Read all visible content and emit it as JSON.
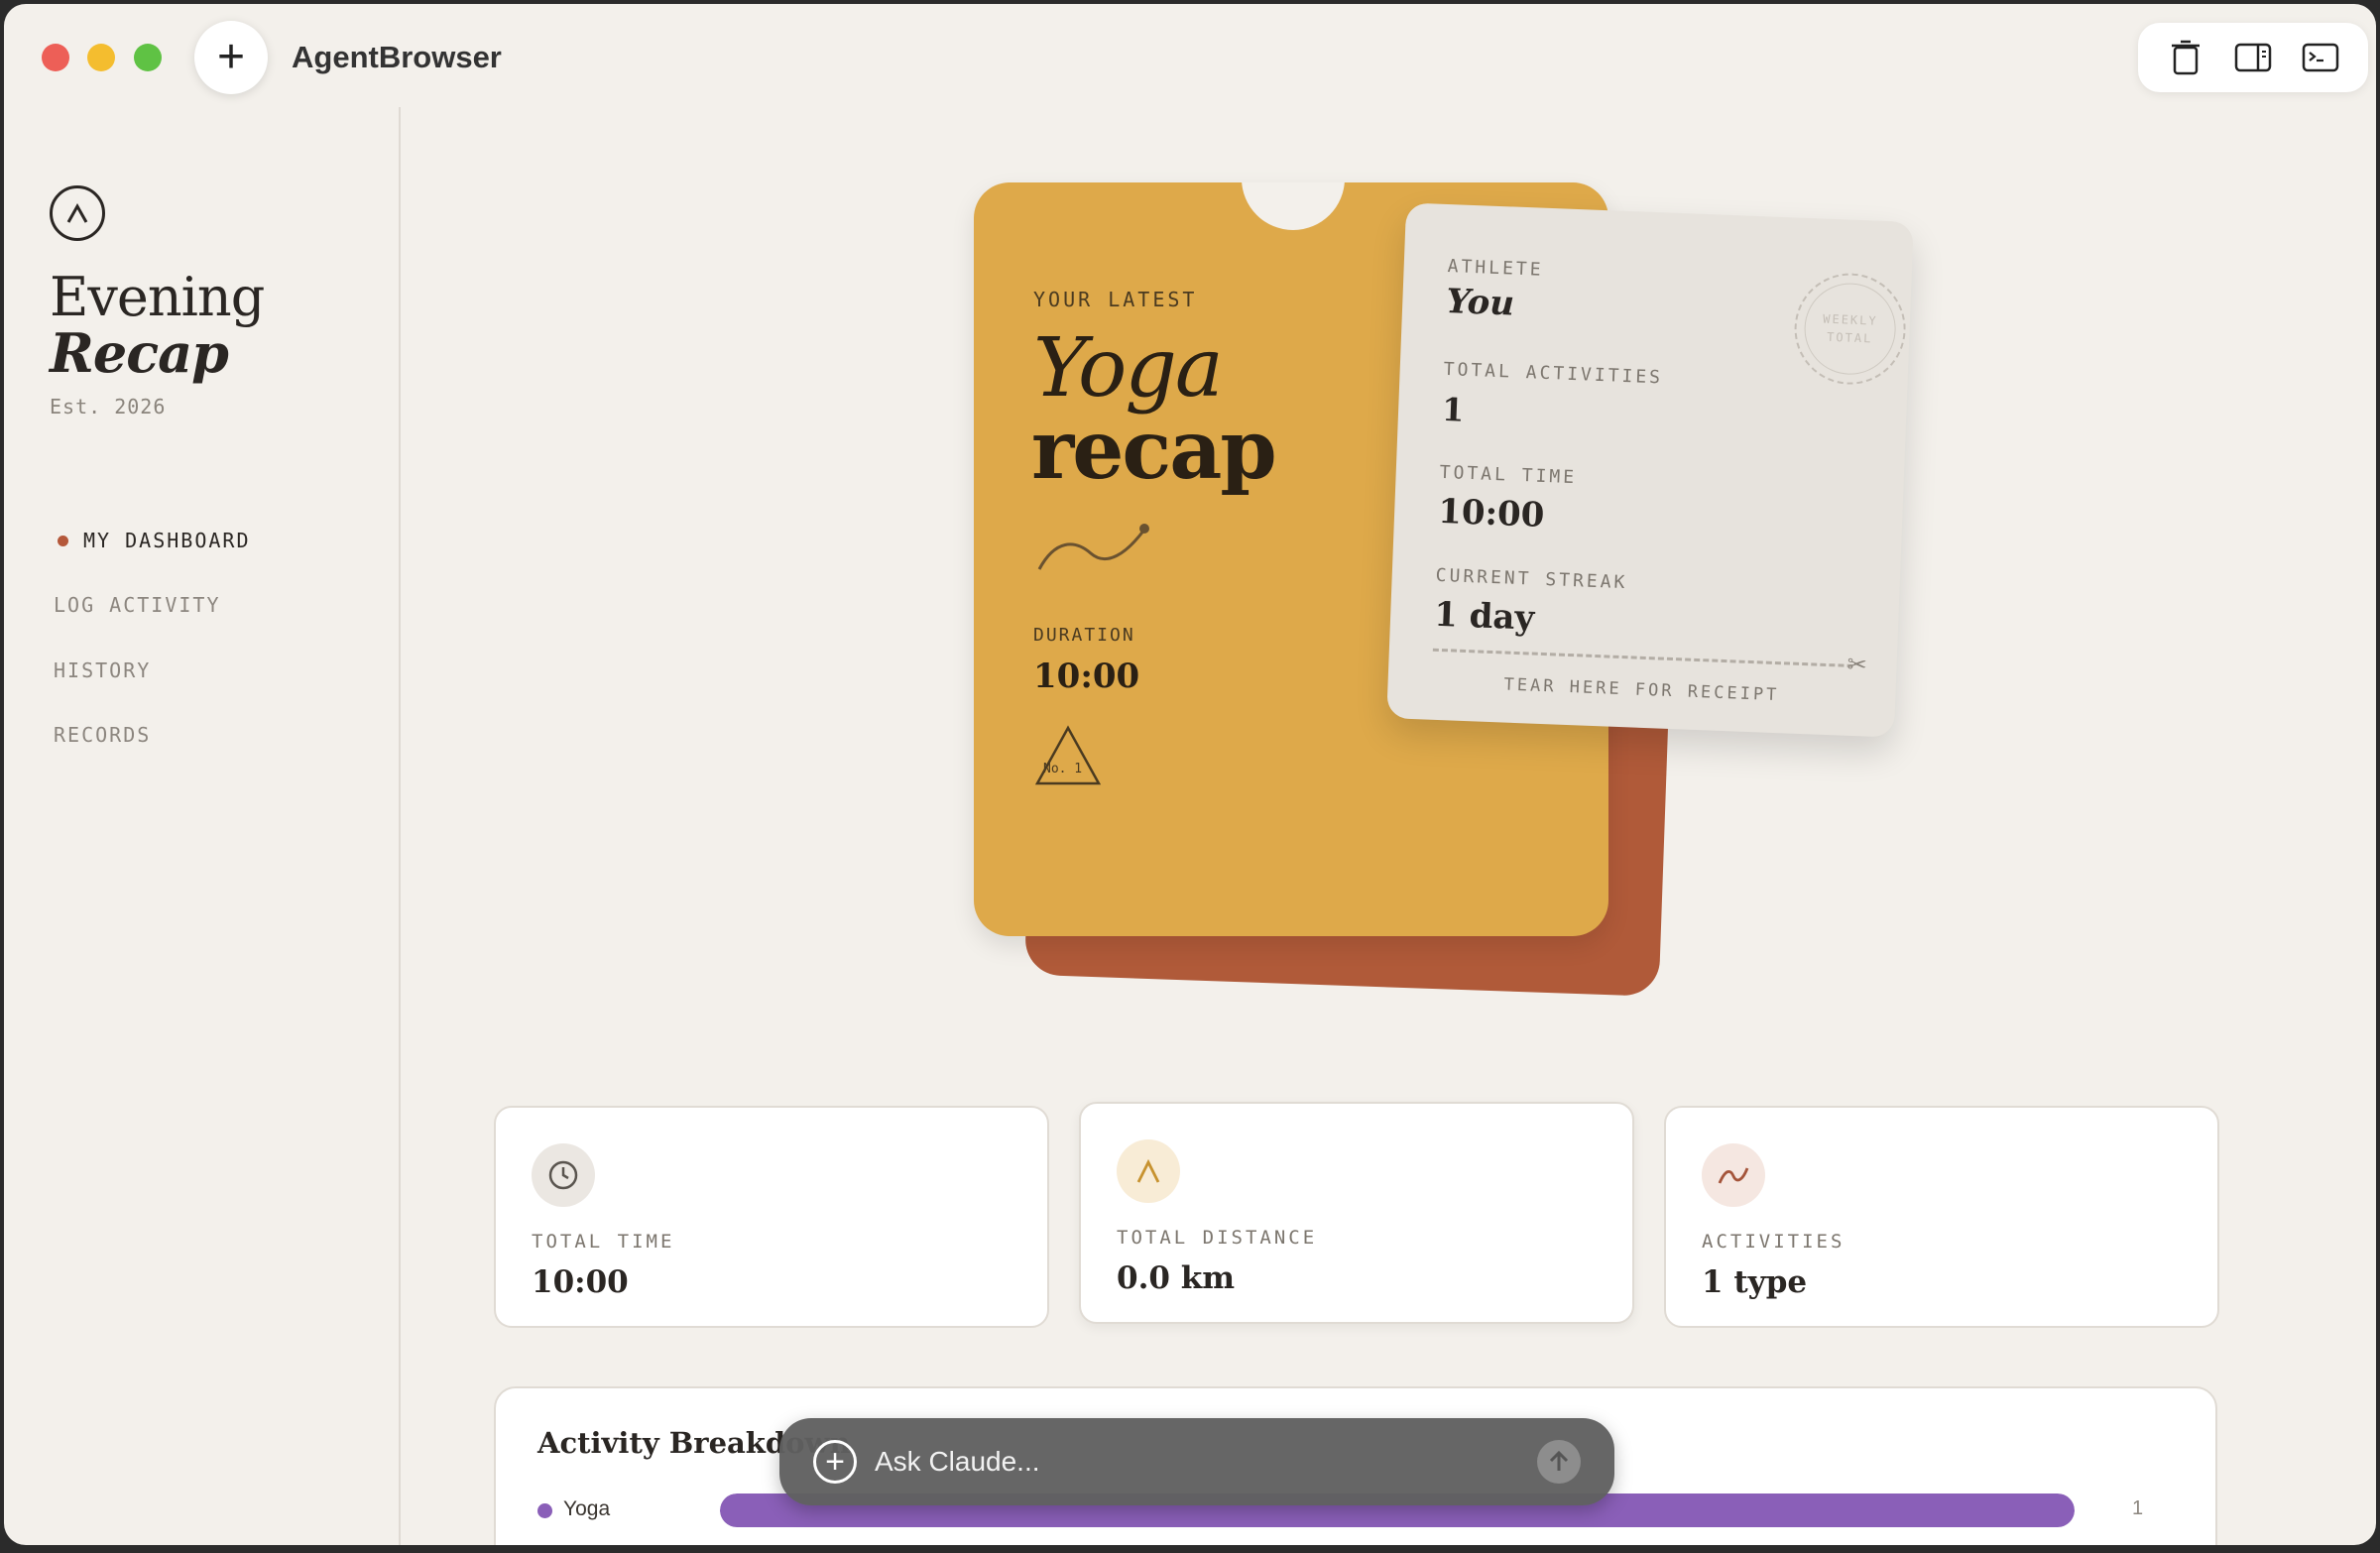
{
  "app": {
    "title": "AgentBrowser"
  },
  "sidebar": {
    "brand_line1": "Evening",
    "brand_line2": "Recap",
    "established": "Est. 2026",
    "nav": [
      {
        "label": "MY DASHBOARD",
        "active": true
      },
      {
        "label": "LOG ACTIVITY",
        "active": false
      },
      {
        "label": "HISTORY",
        "active": false
      },
      {
        "label": "RECORDS",
        "active": false
      }
    ]
  },
  "hero_card": {
    "kicker": "YOUR LATEST",
    "title_italic": "Yoga",
    "title_bold": "recap",
    "duration_label": "DURATION",
    "duration_value": "10:00",
    "badge_text": "No. 1"
  },
  "receipt": {
    "athlete_label": "ATHLETE",
    "athlete_value": "You",
    "stamp_line1": "WEEKLY",
    "stamp_line2": "TOTAL",
    "total_activities_label": "TOTAL ACTIVITIES",
    "total_activities_value": "1",
    "total_time_label": "TOTAL TIME",
    "total_time_value": "10:00",
    "streak_label": "CURRENT STREAK",
    "streak_value": "1 day",
    "tear_text": "TEAR HERE FOR RECEIPT"
  },
  "stats": [
    {
      "label": "TOTAL TIME",
      "value": "10:00",
      "icon": "clock-icon",
      "icon_bg": "#ebe7e2",
      "icon_color": "#5a554f"
    },
    {
      "label": "TOTAL DISTANCE",
      "value": "0.0 km",
      "icon": "peak-icon",
      "icon_bg": "#f8ecd6",
      "icon_color": "#c7922f"
    },
    {
      "label": "ACTIVITIES",
      "value": "1 type",
      "icon": "trend-icon",
      "icon_bg": "#f5e7e1",
      "icon_color": "#a4543a"
    }
  ],
  "breakdown": {
    "title": "Activity Breakdown",
    "rows": [
      {
        "name": "Yoga",
        "count": "1",
        "fraction": 1.0,
        "color": "#8a5fb8"
      }
    ]
  },
  "ask": {
    "placeholder": "Ask Claude..."
  },
  "colors": {
    "accent_orange": "#b4583a",
    "card_gold": "#dea94a",
    "card_rust": "#b05a39",
    "background": "#f3f0eb"
  }
}
